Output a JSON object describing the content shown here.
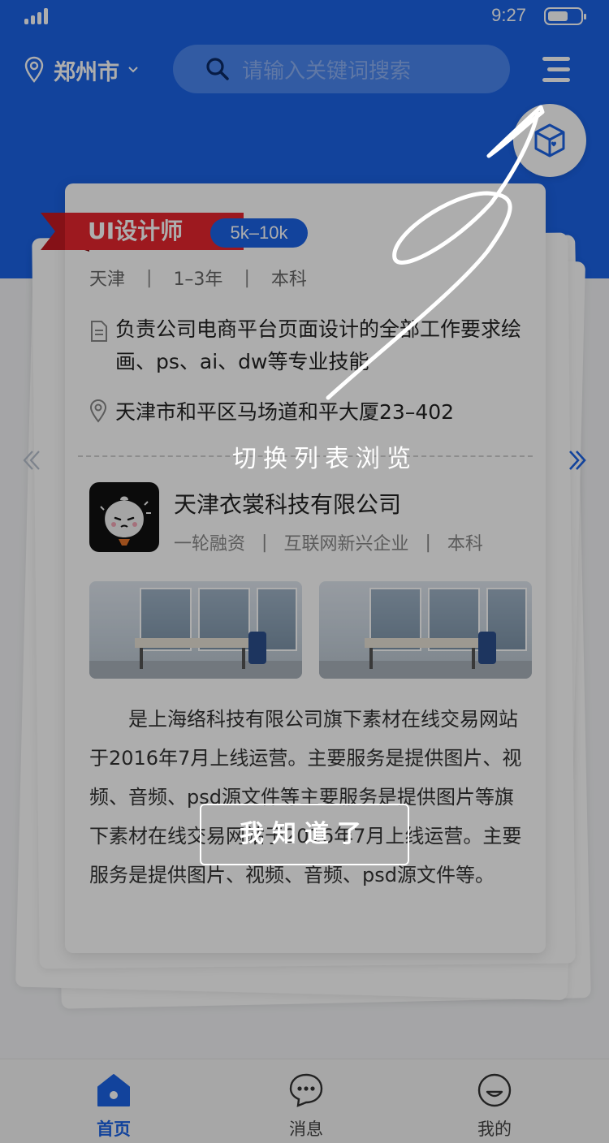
{
  "status_bar": {
    "time": "9:27"
  },
  "header": {
    "city": "郑州市",
    "search_placeholder": "请输入关键词搜索"
  },
  "job": {
    "title": "UI设计师",
    "salary": "5k–10k",
    "location": "天津",
    "experience": "1–3年",
    "education": "本科",
    "description": "负责公司电商平台页面设计的全部工作要求绘画、ps、ai、dw等专业技能",
    "address": "天津市和平区马场道和平大厦23–402"
  },
  "company": {
    "name": "天津衣裳科技有限公司",
    "funding": "一轮融资",
    "industry": "互联网新兴企业",
    "education": "本科",
    "intro": "是上海络科技有限公司旗下素材在线交易网站于2016年7月上线运营。主要服务是提供图片、视频、音频、psd源文件等主要服务是提供图片等旗下素材在线交易网站于2016年7月上线运营。主要服务是提供图片、视频、音频、psd源文件等。"
  },
  "guide": {
    "tip": "切换列表浏览",
    "confirm": "我知道了"
  },
  "tabbar": {
    "items": [
      {
        "label": "首页",
        "icon": "home-icon"
      },
      {
        "label": "消息",
        "icon": "message-icon"
      },
      {
        "label": "我的",
        "icon": "profile-icon"
      }
    ]
  },
  "colors": {
    "brand": "#1b63e6",
    "ribbon": "#e8262f"
  }
}
